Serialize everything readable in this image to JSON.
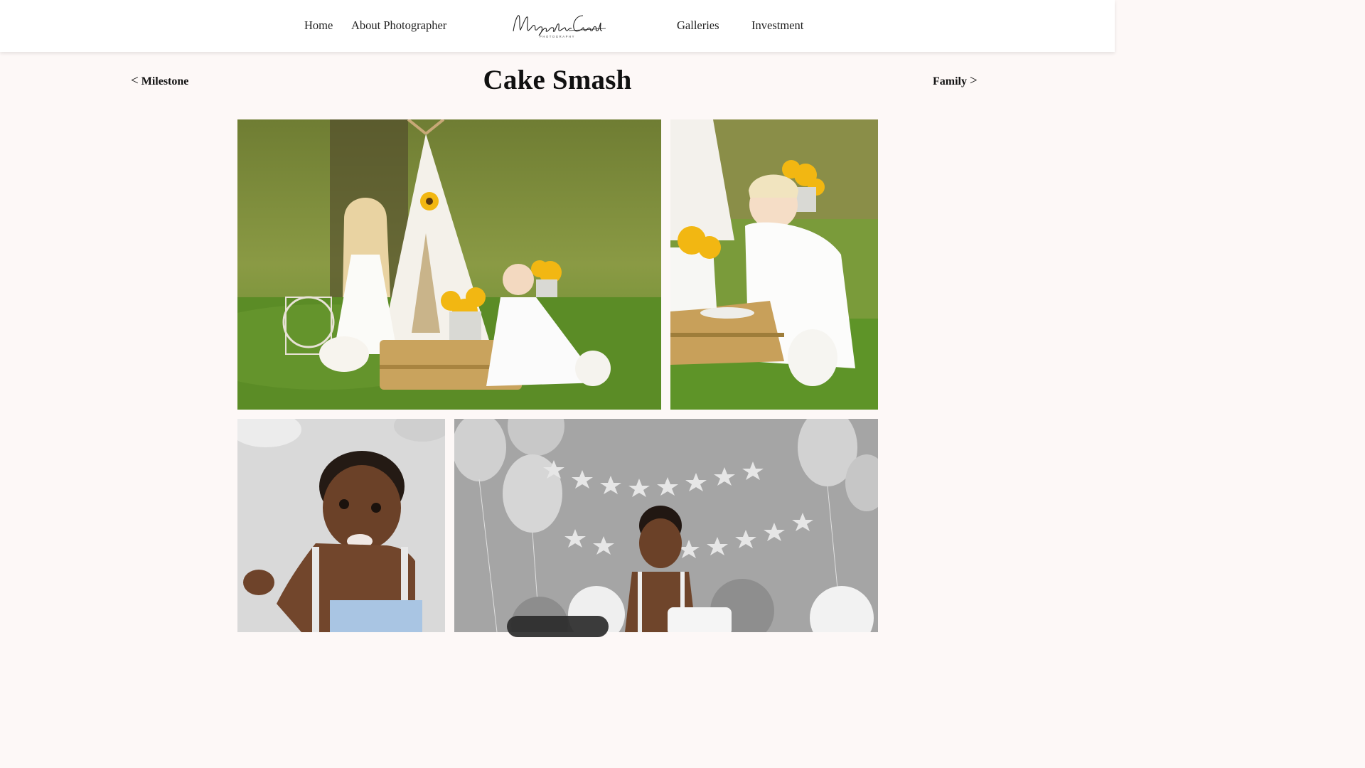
{
  "header": {
    "nav_left": [
      "Home",
      "About Photographer"
    ],
    "nav_right": [
      "Galleries",
      "Investment"
    ],
    "logo_script": "Magnolia Coasts",
    "logo_tagline": "PHOTOGRAPHY"
  },
  "gallery": {
    "title": "Cake Smash",
    "prev": {
      "chevron": "<",
      "label": "Milestone"
    },
    "next": {
      "chevron": ">",
      "label": "Family"
    }
  },
  "icons": {
    "prev": "chevron-left-icon",
    "next": "chevron-right-icon"
  },
  "colors": {
    "page_bg": "#fdf8f7",
    "header_bg": "#ffffff",
    "text": "#111111"
  }
}
